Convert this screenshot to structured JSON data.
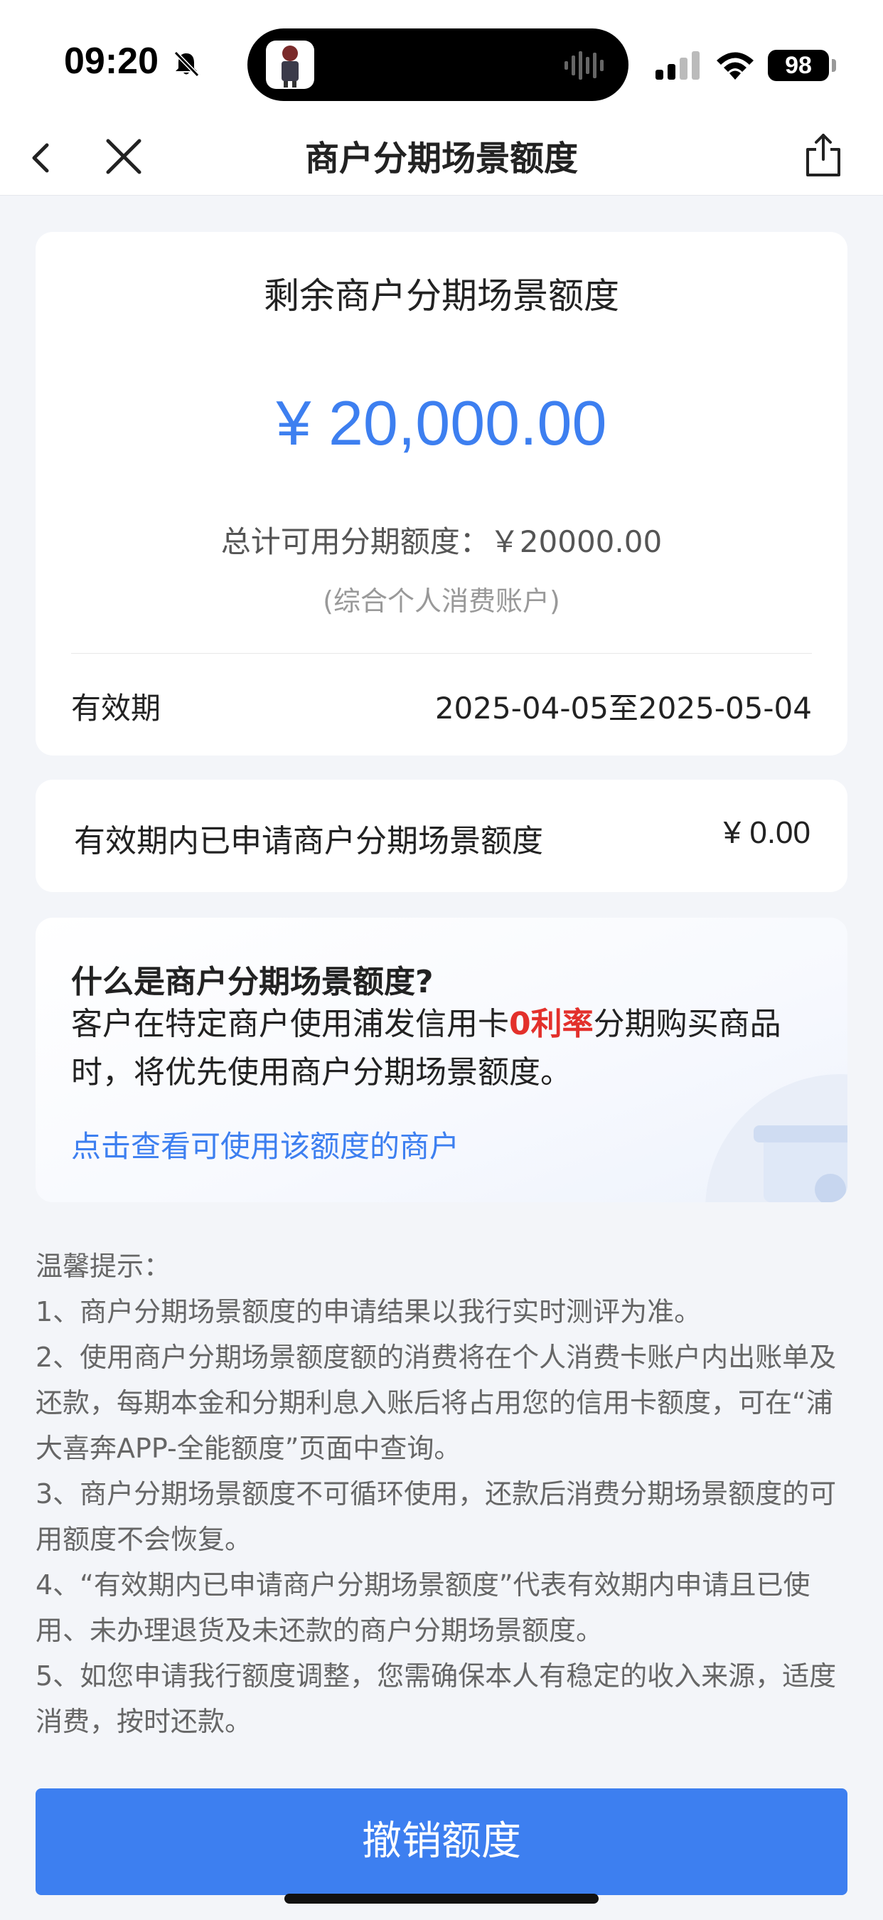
{
  "status_bar": {
    "time": "09:20",
    "battery": "98"
  },
  "nav": {
    "title": "商户分期场景额度"
  },
  "quota": {
    "title": "剩余商户分期场景额度",
    "amount": "¥ 20,000.00",
    "total": "总计可用分期额度：￥20000.00",
    "account_note": "(综合个人消费账户)",
    "valid_label": "有效期",
    "valid_value": "2025-04-05至2025-05-04"
  },
  "applied": {
    "label": "有效期内已申请商户分期场景额度",
    "value": "¥ 0.00"
  },
  "info": {
    "title": "什么是商户分期场景额度?",
    "body_before": "客户在特定商户使用浦发信用卡",
    "body_highlight": "0利率",
    "body_after": "分期购买商品时，将优先使用商户分期场景额度。",
    "link": "点击查看可使用该额度的商户"
  },
  "tips": {
    "heading": "温馨提示：",
    "items": [
      "1、商户分期场景额度的申请结果以我行实时测评为准。",
      "2、使用商户分期场景额度额的消费将在个人消费卡账户内出账单及还款，每期本金和分期利息入账后将占用您的信用卡额度，可在“浦大喜奔APP-全能额度”页面中查询。",
      "3、商户分期场景额度不可循环使用，还款后消费分期场景额度的可用额度不会恢复。",
      "4、“有效期内已申请商户分期场景额度”代表有效期内申请且已使用、未办理退货及未还款的商户分期场景额度。",
      "5、如您申请我行额度调整，您需确保本人有稳定的收入来源，适度消费，按时还款。"
    ]
  },
  "button": {
    "label": "撤销额度"
  },
  "colors": {
    "accent": "#3d7ff0",
    "highlight": "#e3302b",
    "background": "#f3f5f9"
  }
}
